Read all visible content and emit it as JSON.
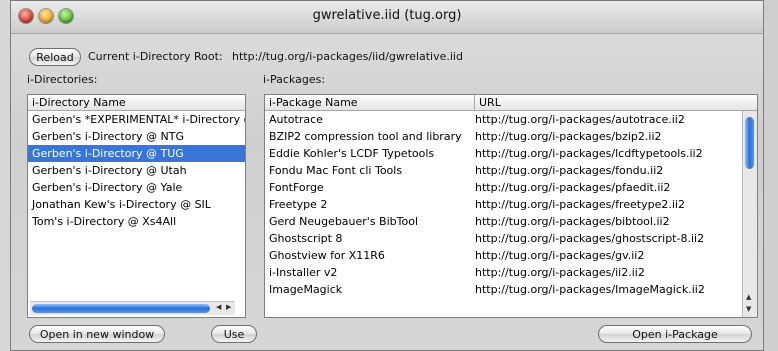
{
  "window": {
    "title": "gwrelative.iid (tug.org)"
  },
  "toolbar": {
    "reload_label": "Reload",
    "root_label": "Current i-Directory Root:",
    "root_url": "http://tug.org/i-packages/iid/gwrelative.iid"
  },
  "directories": {
    "section_label": "i-Directories:",
    "column_header": "i-Directory Name",
    "items": [
      {
        "label": "Gerben's *EXPERIMENTAL* i-Directory @",
        "selected": false
      },
      {
        "label": "Gerben's i-Directory @ NTG",
        "selected": false
      },
      {
        "label": "Gerben's i-Directory @ TUG",
        "selected": true
      },
      {
        "label": "Gerben's i-Directory @ Utah",
        "selected": false
      },
      {
        "label": "Gerben's i-Directory @ Yale",
        "selected": false
      },
      {
        "label": "Jonathan Kew's i-Directory @ SIL",
        "selected": false
      },
      {
        "label": "Tom's i-Directory @ Xs4All",
        "selected": false
      }
    ],
    "open_window_label": "Open in new window",
    "use_label": "Use"
  },
  "packages": {
    "section_label": "i-Packages:",
    "column_headers": [
      "i-Package Name",
      "URL"
    ],
    "rows": [
      [
        "Autotrace",
        "http://tug.org/i-packages/autotrace.ii2"
      ],
      [
        "BZIP2 compression tool and library",
        "http://tug.org/i-packages/bzip2.ii2"
      ],
      [
        "Eddie Kohler's LCDF Typetools",
        "http://tug.org/i-packages/lcdftypetools.ii2"
      ],
      [
        "Fondu Mac Font cli Tools",
        "http://tug.org/i-packages/fondu.ii2"
      ],
      [
        "FontForge",
        "http://tug.org/i-packages/pfaedit.ii2"
      ],
      [
        "Freetype 2",
        "http://tug.org/i-packages/freetype2.ii2"
      ],
      [
        "Gerd Neugebauer's BibTool",
        "http://tug.org/i-packages/bibtool.ii2"
      ],
      [
        "Ghostscript 8",
        "http://tug.org/i-packages/ghostscript-8.ii2"
      ],
      [
        "Ghostview for X11R6",
        "http://tug.org/i-packages/gv.ii2"
      ],
      [
        "i-Installer v2",
        "http://tug.org/i-packages/ii2.ii2"
      ],
      [
        "ImageMagick",
        "http://tug.org/i-packages/ImageMagick.ii2"
      ]
    ],
    "open_package_label": "Open i-Package"
  },
  "colors": {
    "selection": "#3875d7",
    "scroll_thumb": "#2f6fd6"
  }
}
